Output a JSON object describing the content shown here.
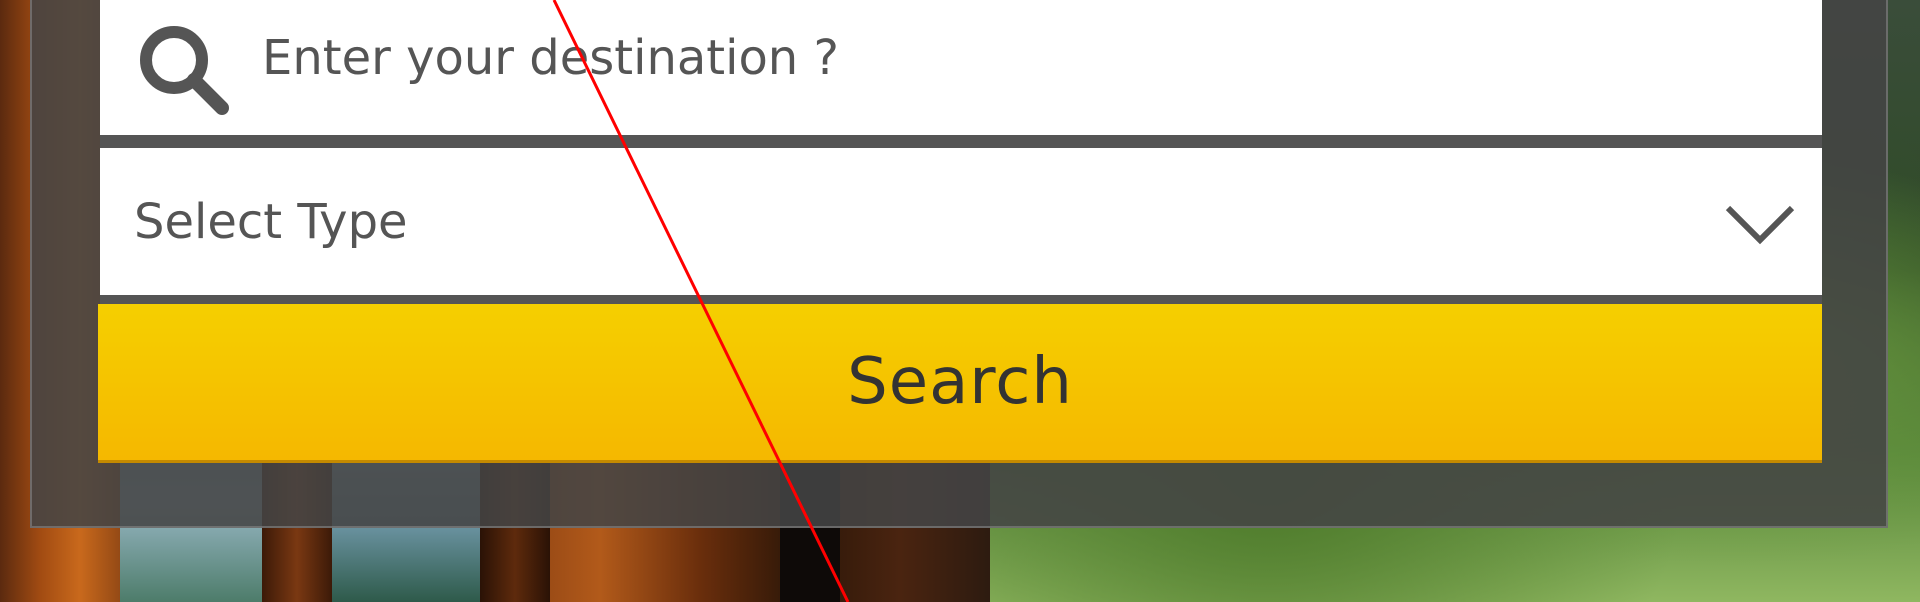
{
  "search_form": {
    "destination_placeholder": "Enter your destination ?",
    "destination_value": "",
    "type_select": {
      "selected": "Select Type"
    },
    "search_button_label": "Search"
  },
  "icons": {
    "search": "search-icon",
    "chevron": "chevron-down-icon"
  },
  "colors": {
    "accent": "#f5c300",
    "panel": "#444444",
    "text": "#555555"
  }
}
